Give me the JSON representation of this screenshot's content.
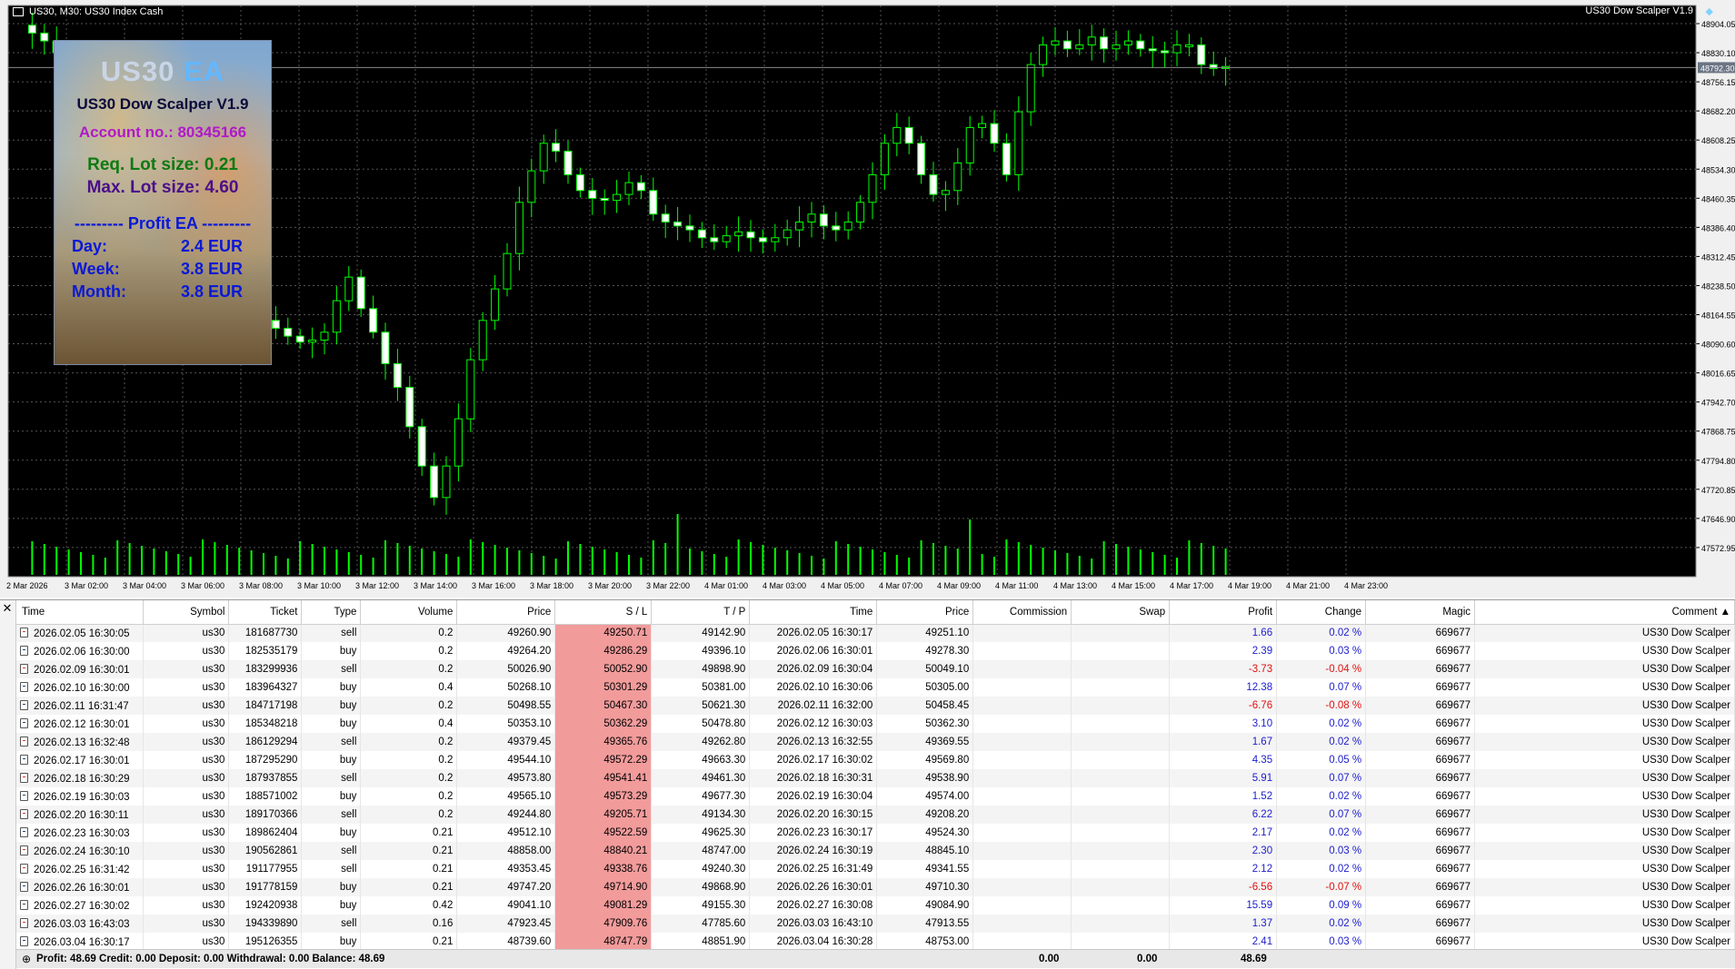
{
  "chart": {
    "symbol_title": "US30, M30:  US30 Index Cash",
    "ea_name": "US30 Dow Scalper V1.9",
    "current_price": "48792.30",
    "price_labels": [
      "48904.05",
      "48830.10",
      "48756.15",
      "48682.20",
      "48608.25",
      "48534.30",
      "48460.35",
      "48386.40",
      "48312.45",
      "48238.50",
      "48164.55",
      "48090.60",
      "48016.65",
      "47942.70",
      "47868.75",
      "47794.80",
      "47720.85",
      "47646.90",
      "47572.95"
    ],
    "time_labels": [
      "2 Mar 2026",
      "3 Mar 02:00",
      "3 Mar 04:00",
      "3 Mar 06:00",
      "3 Mar 08:00",
      "3 Mar 10:00",
      "3 Mar 12:00",
      "3 Mar 14:00",
      "3 Mar 16:00",
      "3 Mar 18:00",
      "3 Mar 20:00",
      "3 Mar 22:00",
      "4 Mar 01:00",
      "4 Mar 03:00",
      "4 Mar 05:00",
      "4 Mar 07:00",
      "4 Mar 09:00",
      "4 Mar 11:00",
      "4 Mar 13:00",
      "4 Mar 15:00",
      "4 Mar 17:00",
      "4 Mar 19:00",
      "4 Mar 21:00",
      "4 Mar 23:00"
    ],
    "colors": {
      "background": "#000000",
      "bull": "#00ff00",
      "bear_body": "#ffffff",
      "grid": "#555555",
      "current_line": "#8a8a8a",
      "price_label_bg": "#6b7483"
    }
  },
  "ea_panel": {
    "logo_main": "US30",
    "logo_accent": "EA",
    "title": "US30 Dow Scalper V1.9",
    "account": "Account no.: 80345166",
    "req_lot": "Req. Lot size: 0.21",
    "max_lot": "Max. Lot size: 4.60",
    "profit_header": "--------- Profit EA ---------",
    "day_label": "Day:",
    "day_value": "2.4 EUR",
    "week_label": "Week:",
    "week_value": "3.8 EUR",
    "month_label": "Month:",
    "month_value": "3.8 EUR"
  },
  "table": {
    "headers": [
      "Time",
      "Symbol",
      "Ticket",
      "Type",
      "Volume",
      "Price",
      "S / L",
      "T / P",
      "Time",
      "Price",
      "Commission",
      "Swap",
      "Profit",
      "Change",
      "Magic",
      "Comment  ▲"
    ],
    "rows": [
      [
        "2026.02.05 16:30:05",
        "us30",
        "181687730",
        "sell",
        "0.2",
        "49260.90",
        "49250.71",
        "49142.90",
        "2026.02.05 16:30:17",
        "49251.10",
        "",
        "",
        "1.66",
        "0.02 %",
        "669677",
        "US30 Dow Scalper"
      ],
      [
        "2026.02.06 16:30:00",
        "us30",
        "182535179",
        "buy",
        "0.2",
        "49264.20",
        "49286.29",
        "49396.10",
        "2026.02.06 16:30:01",
        "49278.30",
        "",
        "",
        "2.39",
        "0.03 %",
        "669677",
        "US30 Dow Scalper"
      ],
      [
        "2026.02.09 16:30:01",
        "us30",
        "183299936",
        "sell",
        "0.2",
        "50026.90",
        "50052.90",
        "49898.90",
        "2026.02.09 16:30:04",
        "50049.10",
        "",
        "",
        "-3.73",
        "-0.04 %",
        "669677",
        "US30 Dow Scalper"
      ],
      [
        "2026.02.10 16:30:00",
        "us30",
        "183964327",
        "buy",
        "0.4",
        "50268.10",
        "50301.29",
        "50381.00",
        "2026.02.10 16:30:06",
        "50305.00",
        "",
        "",
        "12.38",
        "0.07 %",
        "669677",
        "US30 Dow Scalper"
      ],
      [
        "2026.02.11 16:31:47",
        "us30",
        "184717198",
        "buy",
        "0.2",
        "50498.55",
        "50467.30",
        "50621.30",
        "2026.02.11 16:32:00",
        "50458.45",
        "",
        "",
        "-6.76",
        "-0.08 %",
        "669677",
        "US30 Dow Scalper"
      ],
      [
        "2026.02.12 16:30:01",
        "us30",
        "185348218",
        "buy",
        "0.4",
        "50353.10",
        "50362.29",
        "50478.80",
        "2026.02.12 16:30:03",
        "50362.30",
        "",
        "",
        "3.10",
        "0.02 %",
        "669677",
        "US30 Dow Scalper"
      ],
      [
        "2026.02.13 16:32:48",
        "us30",
        "186129294",
        "sell",
        "0.2",
        "49379.45",
        "49365.76",
        "49262.80",
        "2026.02.13 16:32:55",
        "49369.55",
        "",
        "",
        "1.67",
        "0.02 %",
        "669677",
        "US30 Dow Scalper"
      ],
      [
        "2026.02.17 16:30:01",
        "us30",
        "187295290",
        "buy",
        "0.2",
        "49544.10",
        "49572.29",
        "49663.30",
        "2026.02.17 16:30:02",
        "49569.80",
        "",
        "",
        "4.35",
        "0.05 %",
        "669677",
        "US30 Dow Scalper"
      ],
      [
        "2026.02.18 16:30:29",
        "us30",
        "187937855",
        "sell",
        "0.2",
        "49573.80",
        "49541.41",
        "49461.30",
        "2026.02.18 16:30:31",
        "49538.90",
        "",
        "",
        "5.91",
        "0.07 %",
        "669677",
        "US30 Dow Scalper"
      ],
      [
        "2026.02.19 16:30:03",
        "us30",
        "188571002",
        "buy",
        "0.2",
        "49565.10",
        "49573.29",
        "49677.30",
        "2026.02.19 16:30:04",
        "49574.00",
        "",
        "",
        "1.52",
        "0.02 %",
        "669677",
        "US30 Dow Scalper"
      ],
      [
        "2026.02.20 16:30:11",
        "us30",
        "189170366",
        "sell",
        "0.2",
        "49244.80",
        "49205.71",
        "49134.30",
        "2026.02.20 16:30:15",
        "49208.20",
        "",
        "",
        "6.22",
        "0.07 %",
        "669677",
        "US30 Dow Scalper"
      ],
      [
        "2026.02.23 16:30:03",
        "us30",
        "189862404",
        "buy",
        "0.21",
        "49512.10",
        "49522.59",
        "49625.30",
        "2026.02.23 16:30:17",
        "49524.30",
        "",
        "",
        "2.17",
        "0.02 %",
        "669677",
        "US30 Dow Scalper"
      ],
      [
        "2026.02.24 16:30:10",
        "us30",
        "190562861",
        "sell",
        "0.21",
        "48858.00",
        "48840.21",
        "48747.00",
        "2026.02.24 16:30:19",
        "48845.10",
        "",
        "",
        "2.30",
        "0.03 %",
        "669677",
        "US30 Dow Scalper"
      ],
      [
        "2026.02.25 16:31:42",
        "us30",
        "191177955",
        "sell",
        "0.21",
        "49353.45",
        "49338.76",
        "49240.30",
        "2026.02.25 16:31:49",
        "49341.55",
        "",
        "",
        "2.12",
        "0.02 %",
        "669677",
        "US30 Dow Scalper"
      ],
      [
        "2026.02.26 16:30:01",
        "us30",
        "191778159",
        "buy",
        "0.21",
        "49747.20",
        "49714.90",
        "49868.90",
        "2026.02.26 16:30:01",
        "49710.30",
        "",
        "",
        "-6.56",
        "-0.07 %",
        "669677",
        "US30 Dow Scalper"
      ],
      [
        "2026.02.27 16:30:02",
        "us30",
        "192420938",
        "buy",
        "0.42",
        "49041.10",
        "49081.29",
        "49155.30",
        "2026.02.27 16:30:08",
        "49084.90",
        "",
        "",
        "15.59",
        "0.09 %",
        "669677",
        "US30 Dow Scalper"
      ],
      [
        "2026.03.03 16:43:03",
        "us30",
        "194339890",
        "sell",
        "0.16",
        "47923.45",
        "47909.76",
        "47785.60",
        "2026.03.03 16:43:10",
        "47913.55",
        "",
        "",
        "1.37",
        "0.02 %",
        "669677",
        "US30 Dow Scalper"
      ],
      [
        "2026.03.04 16:30:17",
        "us30",
        "195126355",
        "buy",
        "0.21",
        "48739.60",
        "48747.79",
        "48851.90",
        "2026.03.04 16:30:28",
        "48753.00",
        "",
        "",
        "2.41",
        "0.03 %",
        "669677",
        "US30 Dow Scalper"
      ]
    ]
  },
  "summary": {
    "text": "Profit: 48.69  Credit: 0.00  Deposit: 0.00  Withdrawal: 0.00  Balance: 48.69",
    "commission_total": "0.00",
    "swap_total": "0.00",
    "profit_total": "48.69"
  }
}
